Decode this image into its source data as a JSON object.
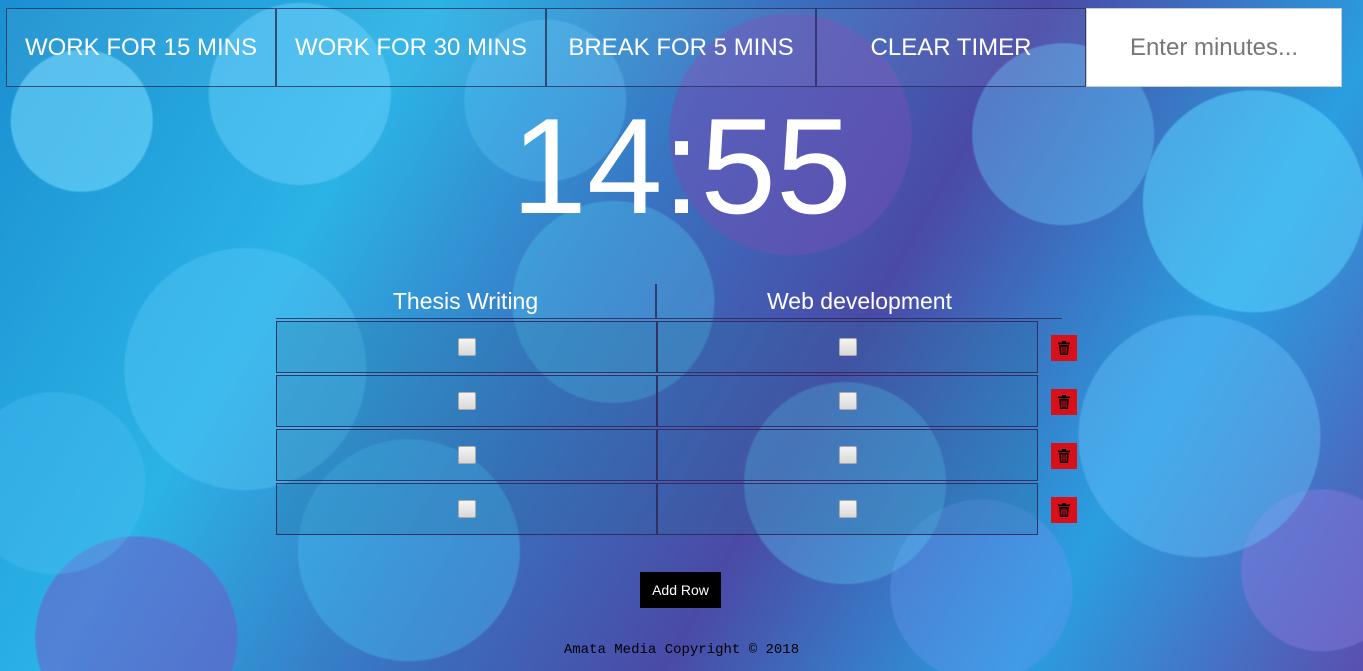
{
  "topbar": {
    "work15_label": "WORK FOR 15 MINS",
    "work30_label": "WORK FOR 30 MINS",
    "break5_label": "BREAK FOR 5 MINS",
    "clear_label": "CLEAR TIMER",
    "minutes_placeholder": "Enter minutes..."
  },
  "timer": {
    "display": "14:55"
  },
  "tasks": {
    "columns": [
      "Thesis Writing",
      "Web development"
    ],
    "rows": [
      {
        "checks": [
          false,
          false
        ]
      },
      {
        "checks": [
          false,
          false
        ]
      },
      {
        "checks": [
          false,
          false
        ]
      },
      {
        "checks": [
          false,
          false
        ]
      }
    ],
    "delete_icon": "trash-icon",
    "delete_color": "#d90f1a"
  },
  "add_row_label": "Add Row",
  "footer": {
    "text": "Amata Media Copyright © 2018"
  }
}
